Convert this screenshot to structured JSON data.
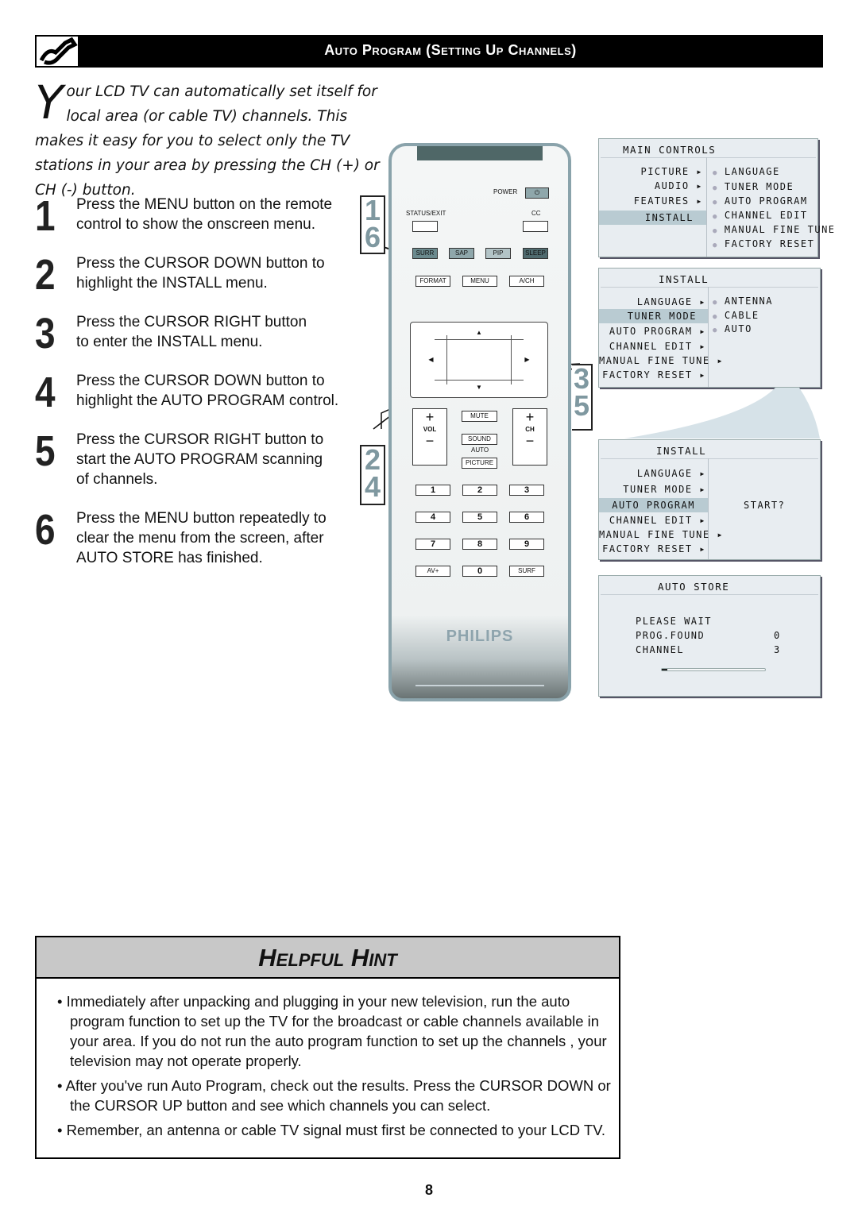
{
  "header": {
    "title": "Auto Program (Setting Up Channels)",
    "icon": "wrench-screwdriver-icon"
  },
  "intro": {
    "dropcap": "Y",
    "text": "our LCD TV can automatically set itself for local area (or cable TV) channels. This makes it easy for you to select only the TV stations in your area by pressing the CH (+) or CH (-) button."
  },
  "steps": [
    {
      "num": "1",
      "text": "Press the MENU button on the remote control to show the onscreen menu."
    },
    {
      "num": "2",
      "text": "Press the CURSOR DOWN button to highlight the INSTALL menu."
    },
    {
      "num": "3",
      "text": "Press the CURSOR RIGHT button to enter the INSTALL menu."
    },
    {
      "num": "4",
      "text": "Press the CURSOR DOWN button to highlight the AUTO PROGRAM control."
    },
    {
      "num": "5",
      "text": "Press the CURSOR RIGHT button to start the AUTO PROGRAM scanning of channels."
    },
    {
      "num": "6",
      "text": "Press the MENU button repeatedly to clear the menu from the screen, after AUTO STORE has finished."
    }
  ],
  "callouts": {
    "a": [
      "1",
      "6"
    ],
    "b": [
      "2",
      "4"
    ],
    "c": [
      "3",
      "5"
    ]
  },
  "remote": {
    "power": "POWER",
    "status_exit": "STATUS/EXIT",
    "cc": "CC",
    "surr": "SURR",
    "sap": "SAP",
    "pip": "PIP",
    "sleep": "SLEEP",
    "format": "FORMAT",
    "menu": "MENU",
    "ach": "A/CH",
    "up": "▲",
    "down": "▼",
    "left": "◀",
    "right": "▶",
    "mute": "MUTE",
    "vol": "VOL",
    "ch": "CH",
    "plus": "+",
    "minus": "−",
    "sound": "SOUND",
    "auto": "AUTO",
    "picture": "PICTURE",
    "digits": [
      "1",
      "2",
      "3",
      "4",
      "5",
      "6",
      "7",
      "8",
      "9"
    ],
    "avplus": "AV+",
    "zero": "0",
    "surf": "SURF",
    "brand": "PHILIPS"
  },
  "menus": {
    "main": {
      "title": "MAIN CONTROLS",
      "left": [
        "PICTURE ▸",
        "AUDIO ▸",
        "FEATURES ▸",
        "INSTALL"
      ],
      "selected": 3,
      "right": [
        "LANGUAGE",
        "TUNER MODE",
        "AUTO PROGRAM",
        "CHANNEL EDIT",
        "MANUAL FINE TUNE",
        "FACTORY RESET"
      ]
    },
    "install1": {
      "title": "INSTALL",
      "left": [
        "LANGUAGE ▸",
        "TUNER MODE",
        "AUTO PROGRAM ▸",
        "CHANNEL EDIT ▸",
        "MANUAL FINE TUNE ▸",
        "FACTORY RESET ▸"
      ],
      "selected": 1,
      "right": [
        "ANTENNA",
        "CABLE",
        "AUTO"
      ]
    },
    "install2": {
      "title": "INSTALL",
      "left": [
        "LANGUAGE ▸",
        "TUNER MODE ▸",
        "AUTO PROGRAM",
        "CHANNEL EDIT ▸",
        "MANUAL FINE TUNE ▸",
        "FACTORY RESET ▸"
      ],
      "selected": 2,
      "right": "START?"
    },
    "autostore": {
      "title": "AUTO STORE",
      "rows": [
        {
          "label": "PLEASE WAIT",
          "value": ""
        },
        {
          "label": "PROG.FOUND",
          "value": "0"
        },
        {
          "label": "CHANNEL",
          "value": "3"
        }
      ],
      "progress": 0.05
    }
  },
  "hint": {
    "title": "Helpful Hint",
    "bullets": [
      "Immediately after unpacking and plugging in your new television, run the auto program function to set up the TV for the broadcast or cable channels available in your area. If you do not run the auto program function to set up the channels , your television may not operate properly.",
      "After you've run Auto Program, check out  the results. Press the CURSOR DOWN or the CURSOR UP button and see which channels you can select.",
      "Remember, an antenna or cable TV signal must first be connected to your LCD TV."
    ]
  },
  "page_number": "8",
  "colors": {
    "accent": "#7f98a0",
    "menu_bg": "#e8edf1",
    "highlight": "#b9cbd2"
  }
}
